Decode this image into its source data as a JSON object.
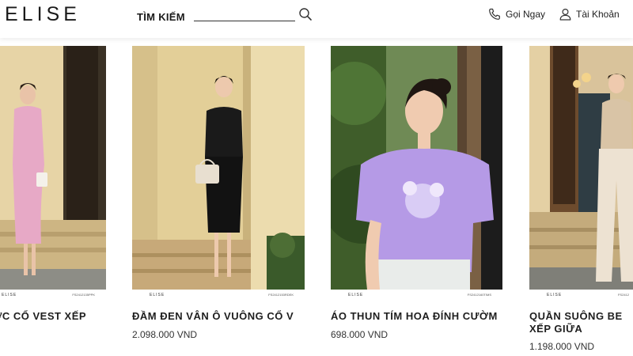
{
  "header": {
    "logo": "ELISE",
    "search_label": "TÌM KIẾM",
    "search_value": "",
    "call_label": "Gọi Ngay",
    "account_label": "Tài Khoản"
  },
  "products": [
    {
      "name": "ƯỚC CỔ VEST XẾP",
      "price": "",
      "brand_tag": "ELISE",
      "sku": "FS2412135PPK"
    },
    {
      "name": "ĐẦM ĐEN VÂN Ô VUÔNG CỔ V",
      "price": "2.098.000 VND",
      "brand_tag": "ELISE",
      "sku": "FS2412153RDEK"
    },
    {
      "name": "ÁO THUN TÍM HOA ĐÍNH CƯỜM",
      "price": "698.000 VND",
      "brand_tag": "ELISE",
      "sku": "FS2412160TIMS"
    },
    {
      "name": "QUẦN SUÔNG BE XẾP GIỮA",
      "price": "1.198.000 VND",
      "brand_tag": "ELISE",
      "sku": "FS2412"
    }
  ],
  "colors": {
    "background": "#ffffff",
    "text": "#1e1e1e",
    "price": "#333333"
  },
  "icons": [
    "search-icon",
    "phone-icon",
    "user-icon"
  ]
}
